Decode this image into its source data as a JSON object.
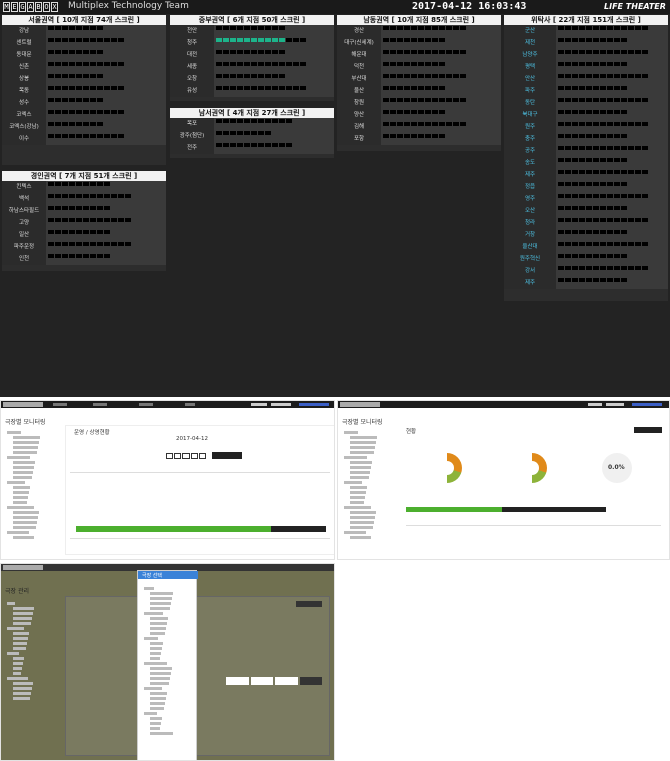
{
  "header": {
    "logo_letters": [
      "M",
      "E",
      "G",
      "A",
      "B",
      "O",
      "X"
    ],
    "team": "Multiplex Technology Team",
    "datetime": "2017-04-12 16:03:43",
    "brand": "LIFE THEATER"
  },
  "regions": [
    {
      "title": "서울권역 [ 10개 지점 74개 스크린 ]",
      "sites": [
        "강남",
        "센트럴",
        "동대문",
        "신촌",
        "상봉",
        "목동",
        "성수",
        "코엑스",
        "코엑스(강남)",
        "이수"
      ]
    },
    {
      "title": "경인권역 [ 7개 지점 51개 스크린 ]",
      "sites": [
        "킨텍스",
        "백석",
        "하남스타필드",
        "고양",
        "일산",
        "파주운정",
        "인천"
      ]
    },
    {
      "title": "중부권역 [ 6개 지점 50개 스크린 ]",
      "sites": [
        "천안",
        "청주",
        "대전",
        "세종",
        "오창",
        "유성"
      ]
    },
    {
      "title": "남서권역 [ 4개 지점 27개 스크린 ]",
      "sites": [
        "목포",
        "광주(첨단)",
        "전주"
      ]
    },
    {
      "title": "남동권역 [ 10개 지점 85개 스크린 ]",
      "sites": [
        "경산",
        "대구(신세계)",
        "해운대",
        "덕천",
        "부산대",
        "울산",
        "창원",
        "양산",
        "김해",
        "포항"
      ]
    },
    {
      "title": "위탁사 [ 22개 지점 151개 스크린 ]",
      "sites": [
        "군산",
        "제천",
        "남양주",
        "평택",
        "안산",
        "파주",
        "동탄",
        "북대구",
        "원주",
        "충주",
        "공주",
        "송도",
        "제주",
        "정읍",
        "영주",
        "오산",
        "청라",
        "거창",
        "울산대",
        "원주혁신",
        "강서",
        "제주"
      ]
    }
  ],
  "monitor_panel": {
    "title": "극장별 모니터링",
    "subtitle": "운영 / 상영현황",
    "date_label": "2017-04-12"
  },
  "detail_panel": {
    "title": "극장별 모니터링",
    "section": "현황",
    "gauge_values": [
      "30%",
      "30%",
      "0.0%"
    ]
  },
  "settings_panel": {
    "title": "극장 관리",
    "modal_title": "극장 선택"
  }
}
